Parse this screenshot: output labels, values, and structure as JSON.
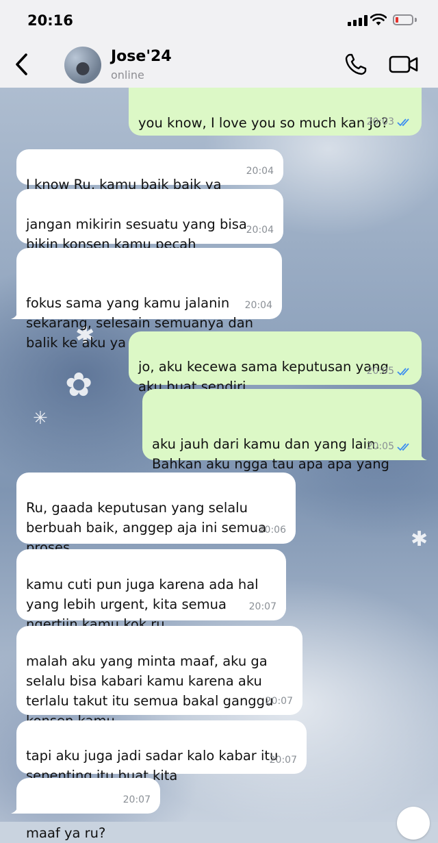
{
  "status_bar": {
    "time": "20:16"
  },
  "header": {
    "contact_name": "Jose'24",
    "contact_status": "online"
  },
  "icons": {
    "back": "chevron-left-icon",
    "call": "phone-icon",
    "video": "video-camera-icon",
    "read_receipt": "double-check-icon"
  },
  "colors": {
    "incoming_bubble": "#ffffff",
    "outgoing_bubble": "#dcf8c6",
    "read_tick": "#3b8df0",
    "battery_low": "#e5322d"
  },
  "messages": [
    {
      "direction": "out",
      "text": "you know, I love you so much kan Jo?",
      "time": "20:03",
      "read": true
    },
    {
      "direction": "in",
      "text": "I know Ru, kamu baik baik ya",
      "time": "20:04"
    },
    {
      "direction": "in",
      "text": "jangan mikirin sesuatu yang bisa\nbikin konsen kamu pecah",
      "time": "20:04"
    },
    {
      "direction": "in",
      "text": "fokus sama yang kamu jalanin\nsekarang, selesain semuanya dan\nbalik ke aku ya ru",
      "time": "20:04"
    },
    {
      "direction": "out",
      "text": "jo, aku kecewa sama keputusan yang\naku buat sendiri",
      "time": "20:05",
      "read": true
    },
    {
      "direction": "out",
      "text": "aku jauh dari kamu dan yang lain.\nBahkan aku ngga tau apa apa yang\nudah terjadi",
      "time": "20:05",
      "read": true
    },
    {
      "direction": "in",
      "text": "Ru, gaada keputusan yang selalu\nberbuah baik, anggep aja ini semua\nproses",
      "time": "20:06"
    },
    {
      "direction": "in",
      "text": "kamu cuti pun juga karena ada hal\nyang lebih urgent, kita semua\nngertiin kamu kok ru",
      "time": "20:07"
    },
    {
      "direction": "in",
      "text": "malah aku yang minta maaf, aku ga\nselalu bisa kabari kamu karena aku\nterlalu takut itu semua bakal ganggu\nkonsen kamu",
      "time": "20:07"
    },
    {
      "direction": "in",
      "text": "tapi aku juga jadi sadar kalo kabar itu\nsepenting itu buat kita",
      "time": "20:07"
    },
    {
      "direction": "in",
      "text": "maaf ya ru?",
      "time": "20:07"
    }
  ]
}
